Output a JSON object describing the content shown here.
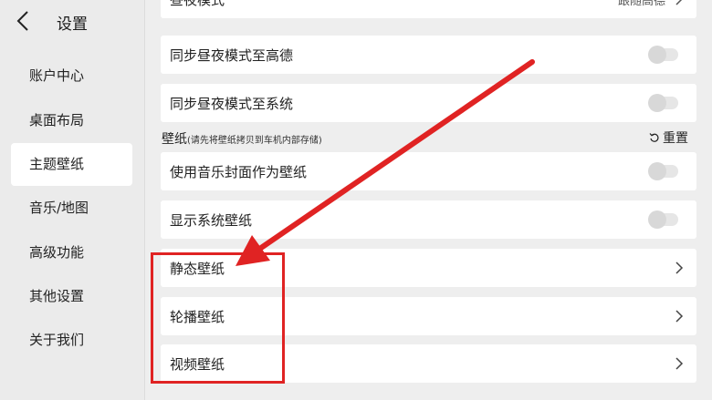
{
  "sidebar": {
    "title": "设置",
    "items": [
      {
        "label": "账户中心",
        "active": false
      },
      {
        "label": "桌面布局",
        "active": false
      },
      {
        "label": "主题壁纸",
        "active": true
      },
      {
        "label": "音乐/地图",
        "active": false
      },
      {
        "label": "高级功能",
        "active": false
      },
      {
        "label": "其他设置",
        "active": false
      },
      {
        "label": "关于我们",
        "active": false
      }
    ]
  },
  "main": {
    "rows_top": [
      {
        "label": "昼夜模式",
        "value": "跟随高德"
      },
      {
        "label": "同步昼夜模式至高德",
        "toggle": false
      },
      {
        "label": "同步昼夜模式至系统",
        "toggle": false
      }
    ],
    "wallpaper_section": {
      "title": "壁纸",
      "note": "(请先将壁纸拷贝到车机内部存储)",
      "reset_label": "重置"
    },
    "rows_wallpaper": [
      {
        "label": "使用音乐封面作为壁纸",
        "toggle": false
      },
      {
        "label": "显示系统壁纸",
        "toggle": false
      },
      {
        "label": "静态壁纸"
      },
      {
        "label": "轮播壁纸"
      },
      {
        "label": "视频壁纸"
      }
    ]
  },
  "colors": {
    "annotation_red": "#e02323",
    "toggle_off": "#d8d8d8"
  }
}
